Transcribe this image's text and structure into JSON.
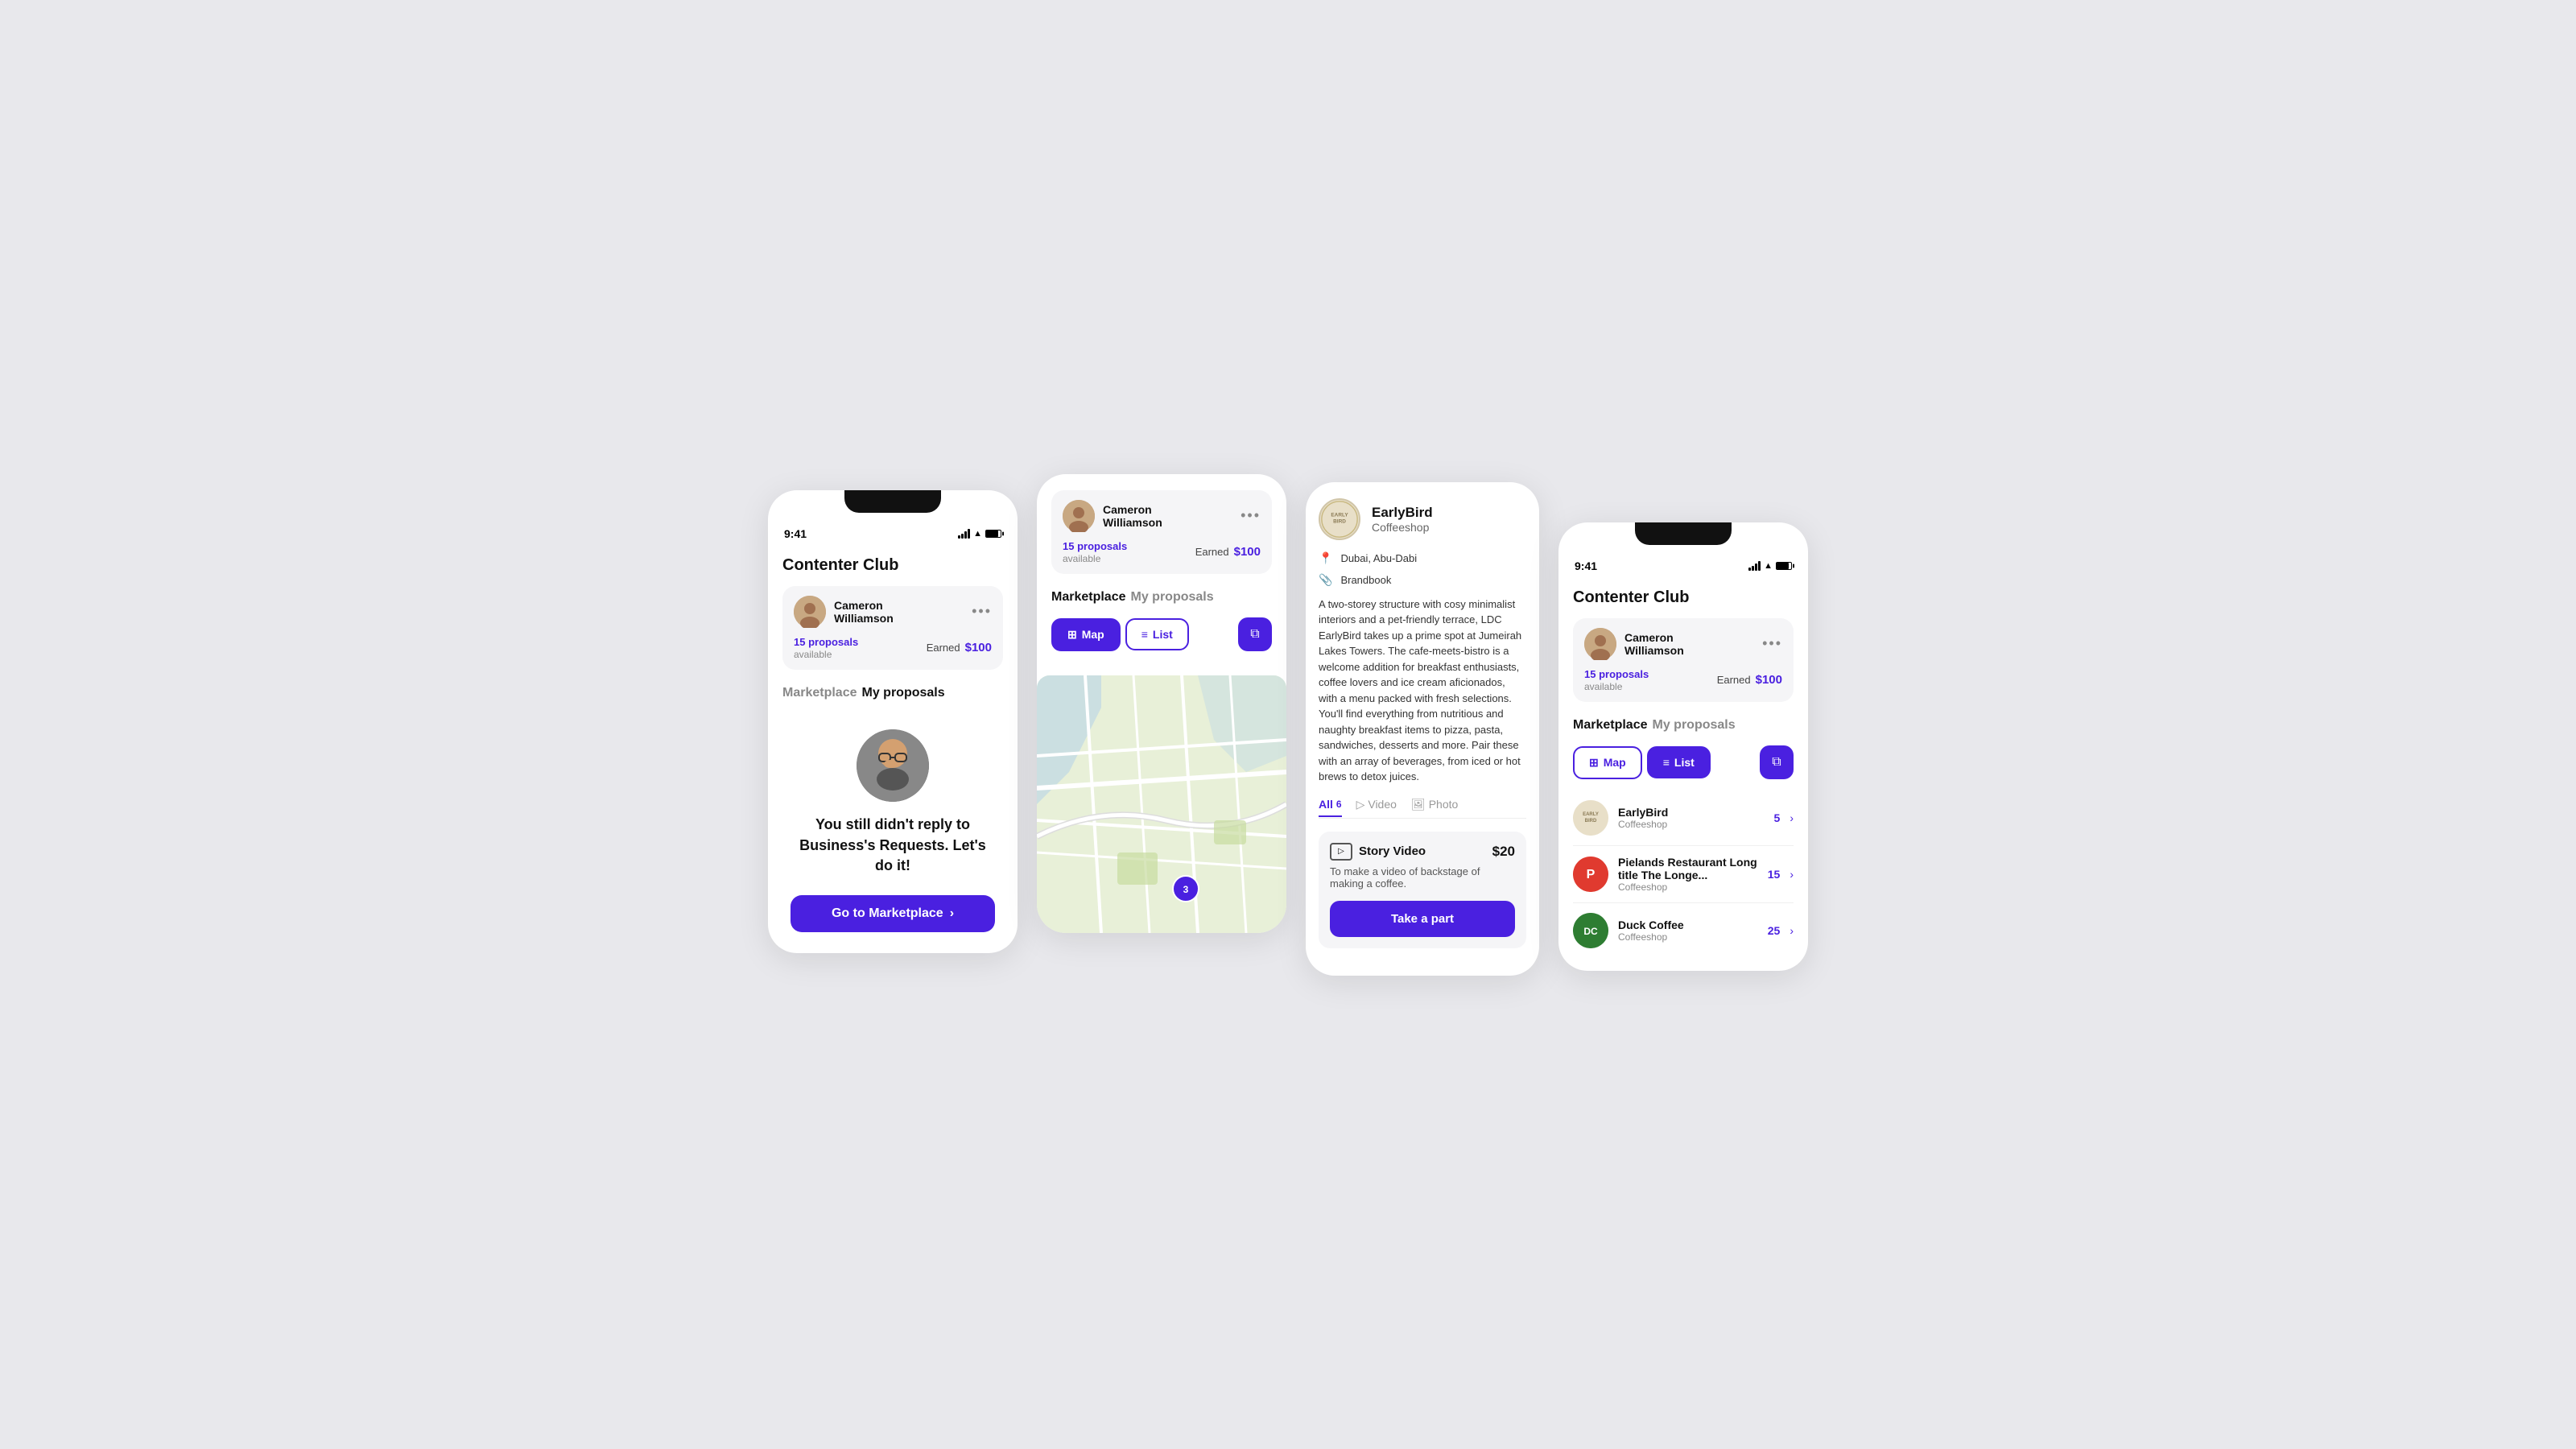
{
  "app": {
    "title": "Contenter Club",
    "status_time": "9:41",
    "user_name": "Cameron\nWilliamson",
    "user_name_single": "Cameron Williamson",
    "proposals_label": "15 proposals",
    "proposals_sub": "available",
    "earned_label": "Earned",
    "earned_amount": "$100",
    "three_dots": "•••"
  },
  "screen1": {
    "empty_heading": "You still didn't reply to Business's Requests. Let's do it!",
    "cta_label": "Go to Marketplace",
    "tab_marketplace": "Marketplace",
    "tab_proposals": "My proposals"
  },
  "screen2": {
    "tab_marketplace": "Marketplace",
    "tab_proposals": "My proposals",
    "map_btn": "Map",
    "list_btn": "List",
    "active_tab": "map",
    "pin_count": "3"
  },
  "screen3": {
    "brand_name": "EarlyBird",
    "brand_type": "Coffeeshop",
    "location": "Dubai, Abu-Dabi",
    "media_label": "Brandbook",
    "description": "A two-storey structure with cosy minimalist interiors and a pet-friendly terrace, LDC EarlyBird takes up a prime spot at Jumeirah Lakes Towers. The cafe-meets-bistro is a welcome addition for breakfast enthusiasts, coffee lovers and ice cream aficionados, with a menu packed with fresh selections. You'll find everything from nutritious and naughty breakfast items to pizza, pasta, sandwiches, desserts and more. Pair these with an array of beverages, from iced or hot brews to detox juices.",
    "filter_all": "All",
    "filter_all_count": "6",
    "filter_video": "Video",
    "filter_photo": "Photo",
    "offer_title": "Story Video",
    "offer_price": "$20",
    "offer_desc": "To make a video of backstage of making a coffee.",
    "take_part_label": "Take a part"
  },
  "screen4": {
    "tab_marketplace": "Marketplace",
    "tab_proposals": "My proposals",
    "map_btn": "Map",
    "list_btn": "List",
    "active_tab": "list",
    "list_items": [
      {
        "name": "EarlyBird",
        "type": "Coffeeshop",
        "count": "5",
        "logo_color": "#e0d5c0",
        "logo_text": "EB",
        "logo_text_color": "#8a7a55"
      },
      {
        "name": "Pielands Restaurant Long title The Longe...",
        "type": "Coffeeshop",
        "count": "15",
        "logo_color": "#e03a2f",
        "logo_text": "P",
        "logo_text_color": "#fff"
      },
      {
        "name": "Duck Coffee",
        "type": "Coffeeshop",
        "count": "25",
        "logo_color": "#3a8a3a",
        "logo_text": "DC",
        "logo_text_color": "#fff"
      }
    ]
  }
}
